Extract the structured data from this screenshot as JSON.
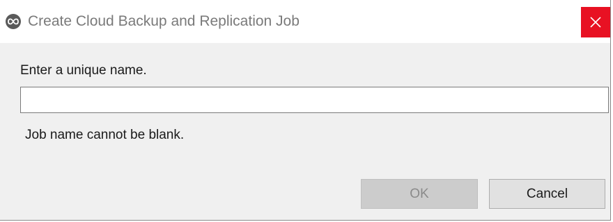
{
  "window": {
    "title": "Create Cloud Backup and Replication Job",
    "app_icon": "infinity-logo-icon",
    "close_icon": "close-icon",
    "close_color": "#e81123"
  },
  "form": {
    "prompt": "Enter a unique name.",
    "name_value": "",
    "name_placeholder": "",
    "error_message": "Job name cannot be blank."
  },
  "buttons": {
    "ok_label": "OK",
    "ok_enabled": false,
    "cancel_label": "Cancel"
  }
}
